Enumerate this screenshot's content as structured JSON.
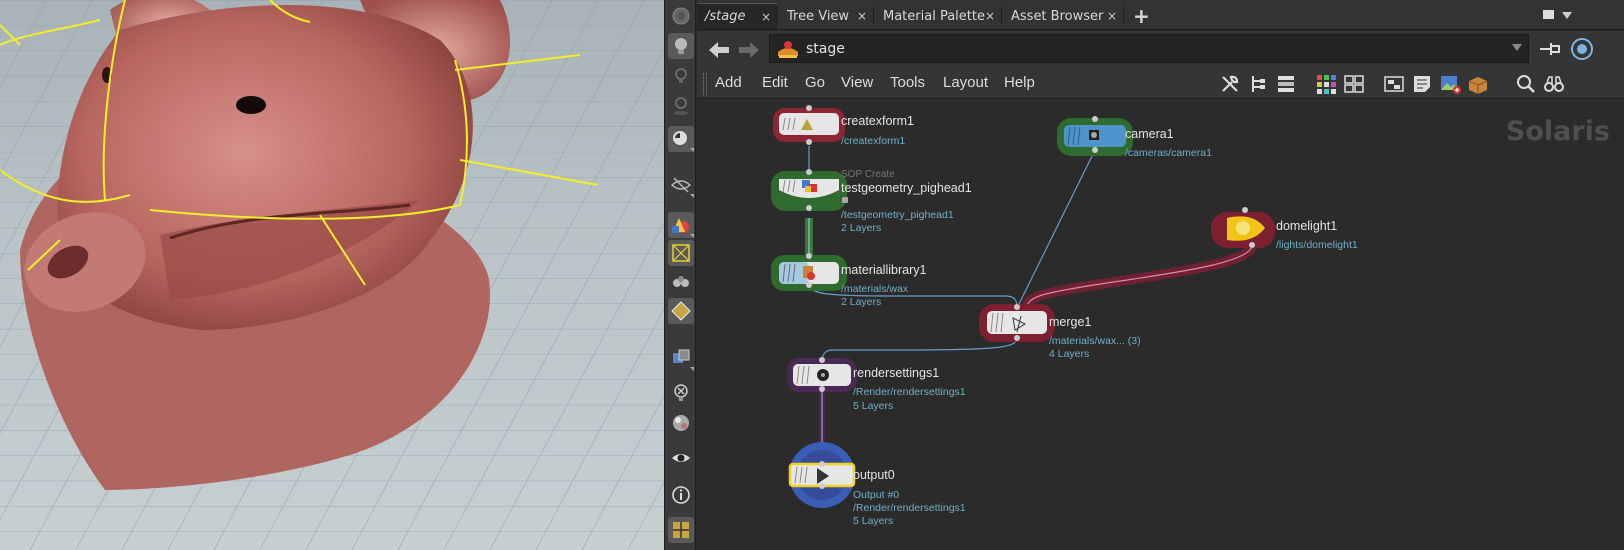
{
  "tabs": [
    {
      "label": "/stage",
      "close": "×",
      "active": true
    },
    {
      "label": "Tree View",
      "close": "×",
      "active": false
    },
    {
      "label": "Material Palette",
      "close": "×",
      "active": false
    },
    {
      "label": "Asset Browser",
      "close": "×",
      "active": false
    }
  ],
  "add_tab": "+",
  "path": {
    "value": "stage"
  },
  "menu": [
    "Add",
    "Edit",
    "Go",
    "View",
    "Tools",
    "Layout",
    "Help"
  ],
  "network_context": "Solaris",
  "nodes": {
    "createxform1": {
      "name": "createxform1",
      "path": "/createxform1"
    },
    "testgeometry": {
      "type": "SOP Create",
      "name": "testgeometry_pighead1",
      "path": "/testgeometry_pighead1",
      "layers": "2 Layers"
    },
    "materiallibrary1": {
      "name": "materiallibrary1",
      "path": "/materials/wax",
      "layers": "2 Layers"
    },
    "camera1": {
      "name": "camera1",
      "path": "/cameras/camera1"
    },
    "domelight1": {
      "name": "domelight1",
      "path": "/lights/domelight1"
    },
    "merge1": {
      "name": "merge1",
      "path": "/materials/wax... (3)",
      "layers": "4 Layers"
    },
    "rendersettings1": {
      "name": "rendersettings1",
      "path": "/Render/rendersettings1",
      "layers": "5 Layers"
    },
    "output0": {
      "name": "output0",
      "type_line": "Output #0",
      "path": "/Render/rendersettings1",
      "layers": "5 Layers"
    }
  },
  "icons": {
    "side_toolbar": [
      "display-options-icon",
      "headlight-icon",
      "normal-light-icon",
      "high-quality-light-icon",
      "shadow-icon",
      "visibility-icon",
      "shaded-mode-icon",
      "selection-icon",
      "snapping-icon",
      "wireframe-icon",
      "background-icon",
      "xray-icon",
      "material-ball-icon",
      "eye-icon",
      "info-icon",
      "layout-icon"
    ],
    "menubar": [
      "wrench-icon",
      "tree-icon",
      "list-icon",
      "grid-color-icon",
      "grid-list-icon",
      "network-icon",
      "sticky-note-icon",
      "image-add-icon",
      "box-icon",
      "search-icon",
      "binoculars-icon"
    ]
  },
  "colors": {
    "createxform": "#8c2634",
    "geometry_green": "#2f6b2f",
    "camera_blue": "#4e93c9",
    "domelight_red": "#7d2030",
    "render_purple": "#4a2a55",
    "output_blue": "#3a5db5",
    "node_path": "#6fb0c8",
    "guide_yellow": "#f2ee2a"
  }
}
